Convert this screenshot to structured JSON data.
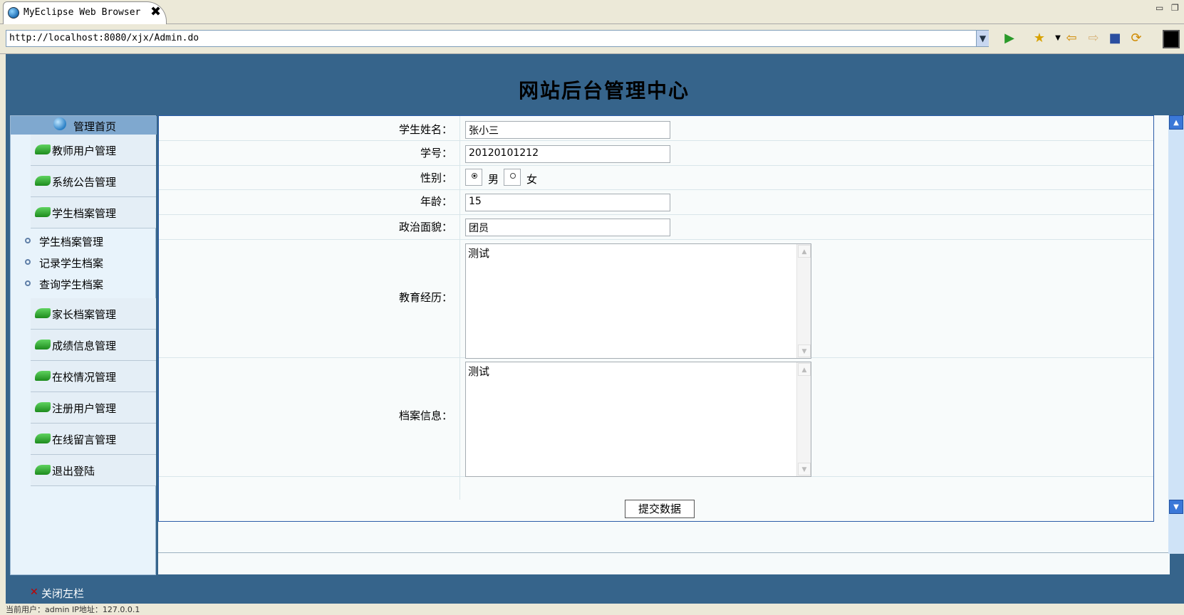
{
  "browser": {
    "tab_title": "MyEclipse Web Browser",
    "close_glyph": "✖",
    "url": "http://localhost:8080/xjx/Admin.do"
  },
  "page": {
    "title": "网站后台管理中心"
  },
  "sidebar": {
    "home_label": "管理首页",
    "items_top": [
      {
        "label": "教师用户管理"
      },
      {
        "label": "系统公告管理"
      },
      {
        "label": "学生档案管理"
      }
    ],
    "subitems": [
      {
        "label": "学生档案管理"
      },
      {
        "label": "记录学生档案"
      },
      {
        "label": "查询学生档案"
      }
    ],
    "items_bottom": [
      {
        "label": "家长档案管理"
      },
      {
        "label": "成绩信息管理"
      },
      {
        "label": "在校情况管理"
      },
      {
        "label": "注册用户管理"
      },
      {
        "label": "在线留言管理"
      },
      {
        "label": "退出登陆"
      }
    ]
  },
  "form": {
    "name_label": "学生姓名：",
    "name_value": "张小三",
    "id_label": "学号：",
    "id_value": "20120101212",
    "gender_label": "性别：",
    "gender_male": "男",
    "gender_female": "女",
    "gender_selected": "男",
    "age_label": "年龄：",
    "age_value": "15",
    "political_label": "政治面貌：",
    "political_value": "团员",
    "education_label": "教育经历：",
    "education_value": "测试",
    "archive_label": "档案信息：",
    "archive_value": "测试",
    "submit_label": "提交数据"
  },
  "footer": {
    "close_left_label": "关闭左栏",
    "status_text": "当前用户：admin  IP地址：127.0.0.1"
  }
}
